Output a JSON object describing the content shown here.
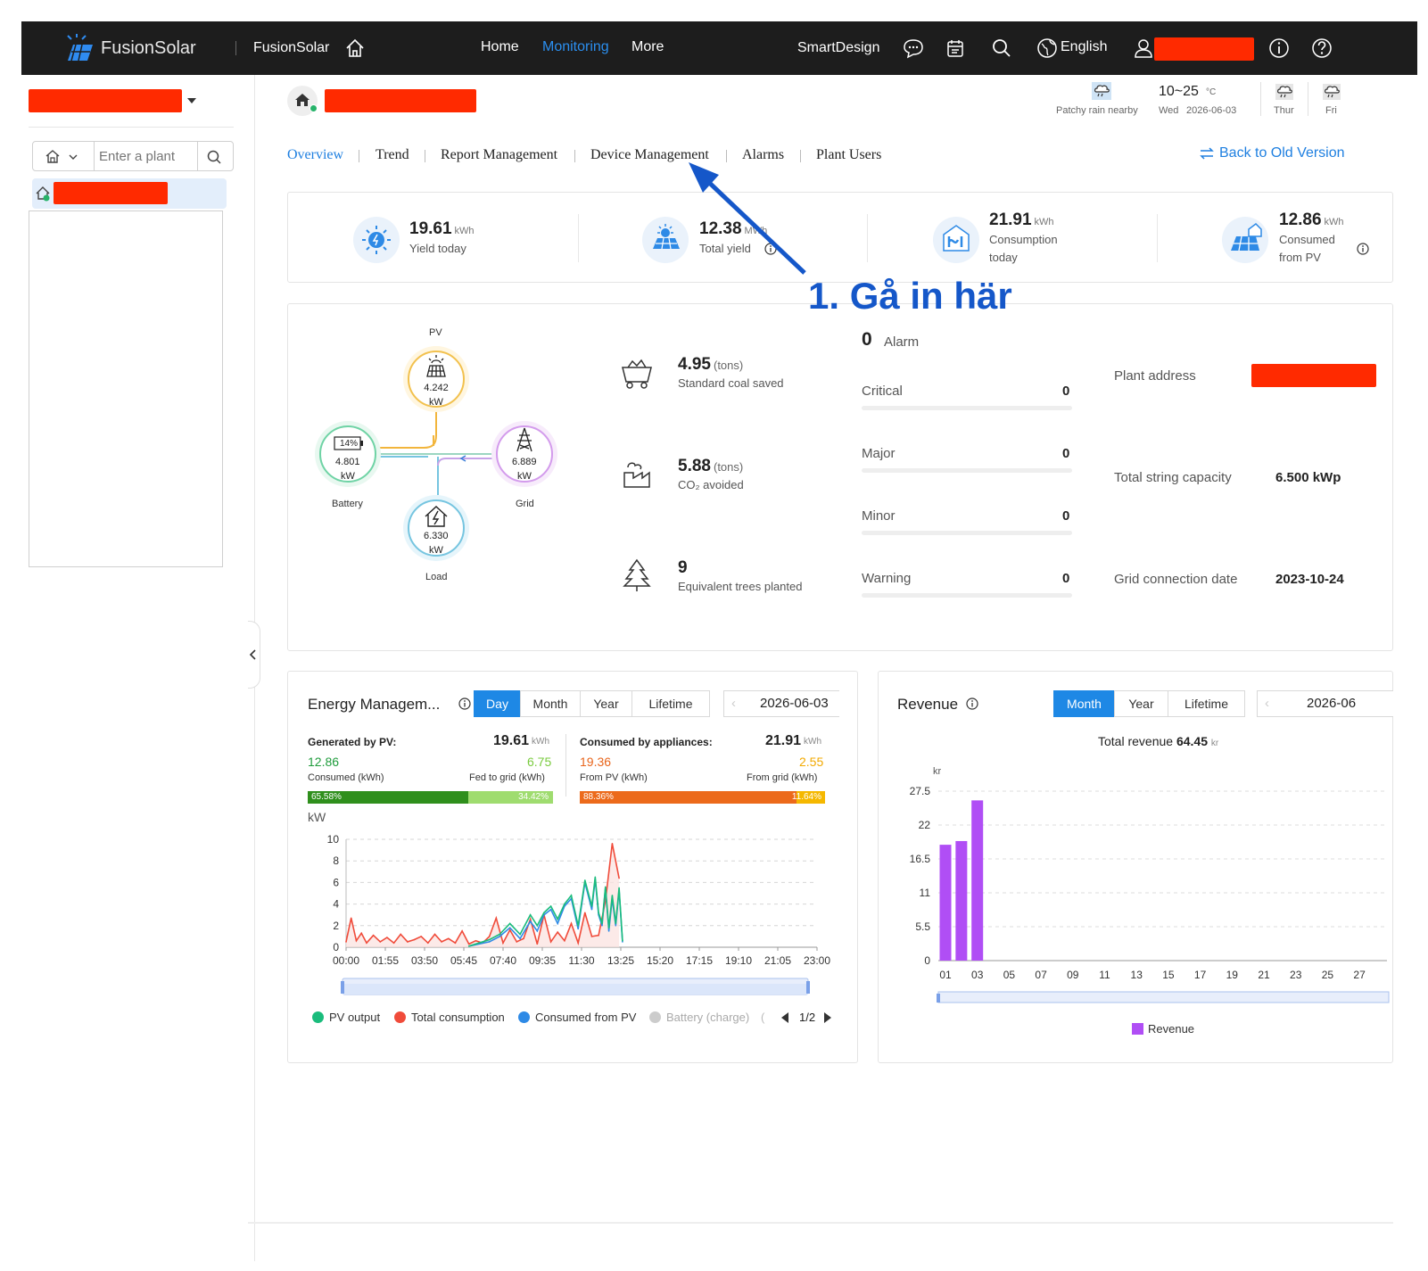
{
  "topbar": {
    "brand": "FusionSolar",
    "app_name": "FusionSolar",
    "nav": [
      "Home",
      "Monitoring",
      "More"
    ],
    "active_nav": "Monitoring",
    "smartdesign": "SmartDesign",
    "language": "English"
  },
  "sidebar": {
    "search_placeholder": "Enter a plant"
  },
  "weather": {
    "today_condition": "Patchy rain nearby",
    "temp_range": "10~25",
    "temp_unit": "°C",
    "today_day": "Wed",
    "today_date": "2026-06-03",
    "next_days": [
      "Thur",
      "Fri"
    ]
  },
  "tabs": [
    "Overview",
    "Trend",
    "Report Management",
    "Device Management",
    "Alarms",
    "Plant Users"
  ],
  "active_tab": "Overview",
  "back_link": "Back to Old Version",
  "annotation": "1. Gå in här",
  "kpis": [
    {
      "value": "19.61",
      "unit": "kWh",
      "label": "Yield today"
    },
    {
      "value": "12.38",
      "unit": "MWh",
      "label": "Total yield"
    },
    {
      "value": "21.91",
      "unit": "kWh",
      "label": "Consumption today"
    },
    {
      "value": "12.86",
      "unit": "kWh",
      "label": "Consumed from PV"
    }
  ],
  "flow": {
    "pv": {
      "label": "PV",
      "value": "4.242",
      "unit": "kW"
    },
    "battery": {
      "label": "Battery",
      "value": "4.801",
      "unit": "kW",
      "soc": "14%"
    },
    "grid": {
      "label": "Grid",
      "value": "6.889",
      "unit": "kW"
    },
    "load": {
      "label": "Load",
      "value": "6.330",
      "unit": "kW"
    }
  },
  "environment": [
    {
      "value": "4.95",
      "unit": "(tons)",
      "label": "Standard coal saved"
    },
    {
      "value": "5.88",
      "unit": "(tons)",
      "label": "CO₂ avoided"
    },
    {
      "value": "9",
      "unit": "",
      "label": "Equivalent trees planted"
    }
  ],
  "alarms": {
    "total": "0",
    "label": "Alarm",
    "rows": [
      {
        "name": "Critical",
        "count": "0"
      },
      {
        "name": "Major",
        "count": "0"
      },
      {
        "name": "Minor",
        "count": "0"
      },
      {
        "name": "Warning",
        "count": "0"
      }
    ]
  },
  "plant_info": {
    "address_label": "Plant address",
    "capacity_label": "Total string capacity",
    "capacity_value": "6.500 kWp",
    "grid_date_label": "Grid connection date",
    "grid_date_value": "2023-10-24"
  },
  "energy": {
    "title": "Energy Managem...",
    "periods": [
      "Day",
      "Month",
      "Year",
      "Lifetime"
    ],
    "active_period": "Day",
    "date": "2026-06-03",
    "generated_label": "Generated by PV:",
    "generated_value": "19.61",
    "unit": "kWh",
    "consumed_pv_value": "12.86",
    "consumed_pv_label": "Consumed (kWh)",
    "fed_grid_value": "6.75",
    "fed_grid_label": "Fed to grid (kWh)",
    "gen_pct_consumed": "65.58%",
    "gen_pct_fed": "34.42%",
    "consumed_label": "Consumed by appliances:",
    "consumed_value": "21.91",
    "from_pv_value": "19.36",
    "from_pv_label": "From PV (kWh)",
    "from_grid_value": "2.55",
    "from_grid_label": "From grid (kWh)",
    "cons_pct_pv": "88.36%",
    "cons_pct_grid": "11.64%",
    "legend": [
      "PV output",
      "Total consumption",
      "Consumed from PV",
      "Battery (charge)"
    ],
    "legend_page": "1/2",
    "colors": {
      "pv": "#1abc7c",
      "consumption": "#f04b3a",
      "from_pv": "#2e8ae6",
      "battery": "#cccccc"
    }
  },
  "revenue": {
    "title": "Revenue",
    "periods": [
      "Month",
      "Year",
      "Lifetime"
    ],
    "active_period": "Month",
    "date": "2026-06",
    "total_label": "Total revenue",
    "total_value": "64.45",
    "currency": "kr",
    "legend": "Revenue",
    "color": "#b04ef5"
  },
  "chart_data": [
    {
      "type": "line",
      "ylabel": "kW",
      "ylim": [
        0,
        10
      ],
      "yticks": [
        "0",
        "2",
        "4",
        "6",
        "8",
        "10"
      ],
      "xticks": [
        "00:00",
        "01:55",
        "03:50",
        "05:45",
        "07:40",
        "09:35",
        "11:30",
        "13:25",
        "15:20",
        "17:15",
        "19:10",
        "21:05",
        "23:00"
      ],
      "series": [
        {
          "name": "Total consumption",
          "x": [
            "00:00",
            "00:15",
            "00:30",
            "00:45",
            "01:00",
            "01:20",
            "01:40",
            "02:00",
            "02:20",
            "02:40",
            "03:00",
            "03:20",
            "03:40",
            "04:00",
            "04:20",
            "04:40",
            "05:00",
            "05:20",
            "05:40",
            "06:00",
            "06:20",
            "06:40",
            "07:00",
            "07:20",
            "07:40",
            "08:00",
            "08:20",
            "08:40",
            "09:00",
            "09:20",
            "09:40",
            "10:00",
            "10:20",
            "10:40",
            "11:00",
            "11:20",
            "11:40",
            "12:00",
            "12:20",
            "12:40",
            "13:00",
            "13:20"
          ],
          "values": [
            0.5,
            2.7,
            0.6,
            1.3,
            0.4,
            1.1,
            0.5,
            0.9,
            0.4,
            1.2,
            0.5,
            0.7,
            1.0,
            0.4,
            1.2,
            0.5,
            0.8,
            0.4,
            1.5,
            0.3,
            0.6,
            0.4,
            1.0,
            2.7,
            0.4,
            1.6,
            0.5,
            0.8,
            2.6,
            0.3,
            3.0,
            0.5,
            1.4,
            0.6,
            2.2,
            0.4,
            3.2,
            1.0,
            1.1,
            4.3,
            9.6,
            6.4
          ]
        },
        {
          "name": "Consumed from PV",
          "x": [
            "06:00",
            "06:30",
            "07:00",
            "07:30",
            "08:00",
            "08:30",
            "09:00",
            "09:20",
            "09:40",
            "10:00",
            "10:20",
            "10:40",
            "11:00",
            "11:20",
            "11:40",
            "12:00",
            "12:10",
            "12:20",
            "12:30",
            "12:40",
            "12:50",
            "13:00",
            "13:10",
            "13:20",
            "13:30"
          ],
          "values": [
            0.1,
            0.3,
            0.5,
            1.0,
            1.8,
            0.8,
            2.4,
            1.5,
            3.0,
            3.5,
            2.2,
            3.8,
            4.5,
            1.7,
            6.0,
            3.5,
            6.3,
            3.0,
            2.0,
            5.5,
            1.5,
            4.5,
            2.0,
            5.3,
            0.5
          ]
        },
        {
          "name": "PV output",
          "x": [
            "06:00",
            "06:30",
            "07:00",
            "07:30",
            "08:00",
            "08:30",
            "09:00",
            "09:20",
            "09:40",
            "10:00",
            "10:20",
            "10:40",
            "11:00",
            "11:20",
            "11:40",
            "12:00",
            "12:10",
            "12:20",
            "12:30",
            "12:40",
            "12:50",
            "13:00",
            "13:10",
            "13:20",
            "13:30"
          ],
          "values": [
            0.1,
            0.4,
            0.7,
            1.2,
            2.2,
            1.2,
            3.0,
            2.0,
            3.2,
            3.8,
            2.6,
            4.0,
            4.8,
            2.0,
            6.2,
            3.8,
            6.5,
            3.2,
            2.2,
            5.6,
            1.8,
            4.8,
            2.2,
            5.5,
            0.6
          ]
        }
      ]
    },
    {
      "type": "bar",
      "ylabel": "kr",
      "ylim": [
        0,
        27.5
      ],
      "yticks": [
        "0",
        "5.5",
        "11",
        "16.5",
        "22",
        "27.5"
      ],
      "categories": [
        "01",
        "02",
        "03"
      ],
      "xticks": [
        "01",
        "03",
        "05",
        "07",
        "09",
        "11",
        "13",
        "15",
        "17",
        "19",
        "21",
        "23",
        "25",
        "27"
      ],
      "series": [
        {
          "name": "Revenue",
          "values": [
            18.8,
            19.4,
            26.0
          ]
        }
      ]
    }
  ]
}
